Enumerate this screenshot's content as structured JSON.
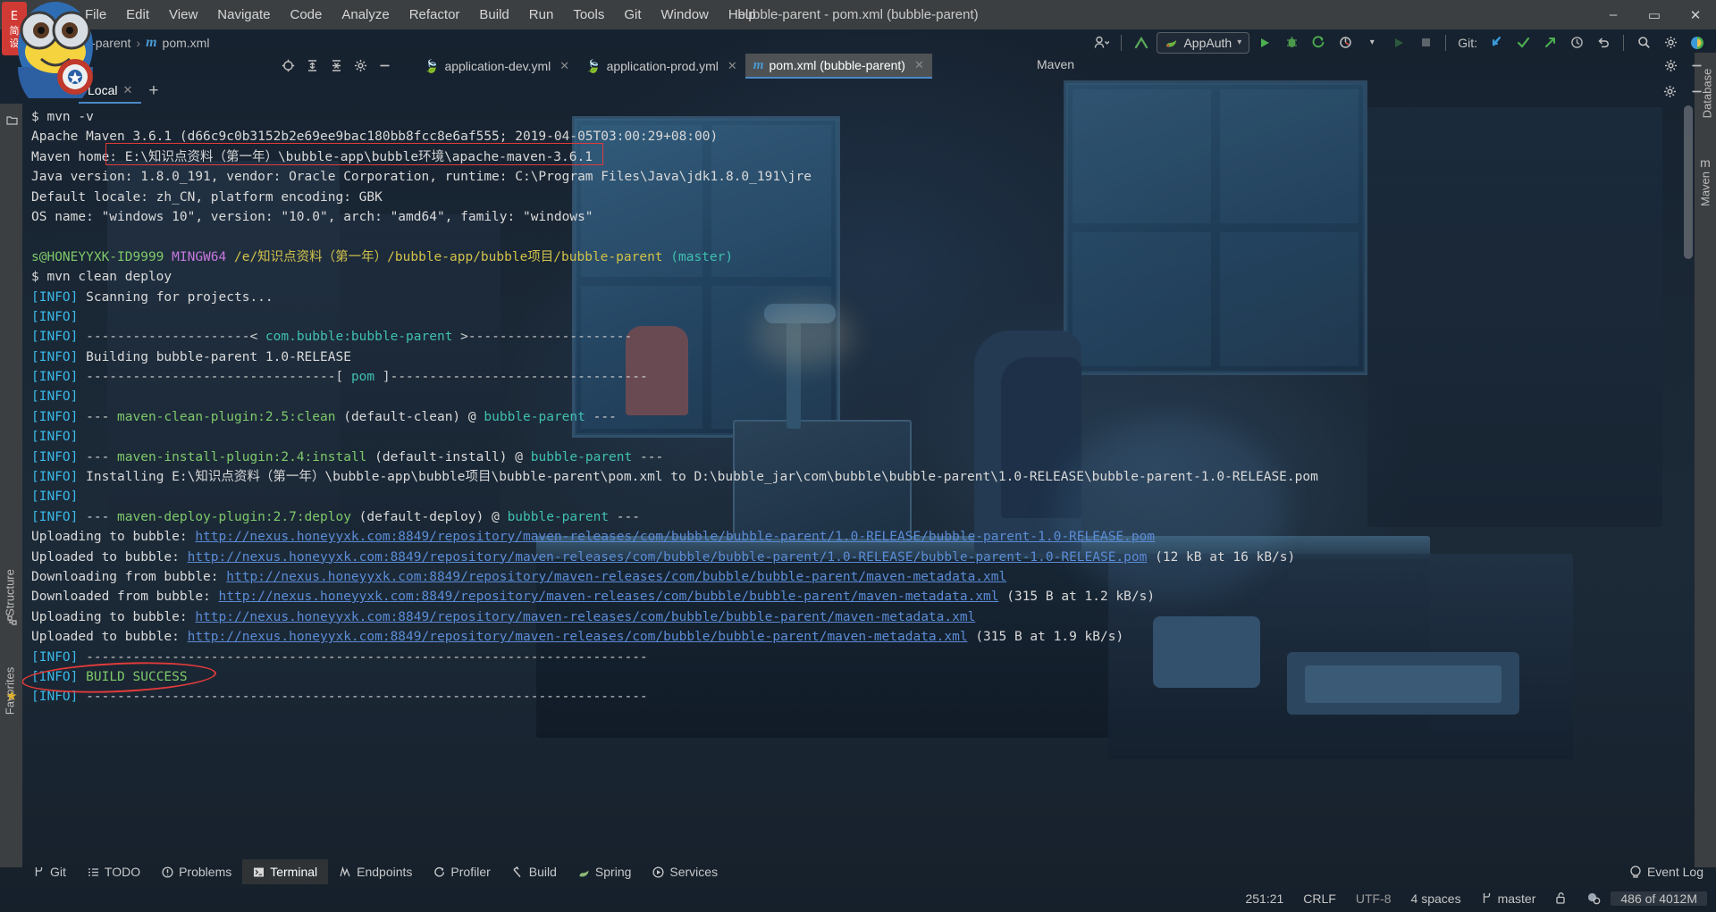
{
  "window": {
    "title": "bubble-parent - pom.xml (bubble-parent)",
    "minimize": "–",
    "maximize": "▭",
    "close": "✕"
  },
  "menu": [
    {
      "label": "File"
    },
    {
      "label": "Edit"
    },
    {
      "label": "View"
    },
    {
      "label": "Navigate"
    },
    {
      "label": "Code"
    },
    {
      "label": "Analyze"
    },
    {
      "label": "Refactor"
    },
    {
      "label": "Build"
    },
    {
      "label": "Run"
    },
    {
      "label": "Tools"
    },
    {
      "label": "Git"
    },
    {
      "label": "Window"
    },
    {
      "label": "Help"
    }
  ],
  "breadcrumb": {
    "project": "bubble-parent",
    "separator": "›",
    "file": "pom.xml",
    "file_icon": "m"
  },
  "toolbar": {
    "run_config": "AppAuth",
    "run_config_caret": "▾",
    "git_label": "Git:",
    "icons": [
      "user-avatar-icon",
      "update-project-icon",
      "run-icon",
      "debug-icon",
      "run-with-coverage-icon",
      "profile-icon",
      "stop-icon",
      "git-update-icon",
      "git-commit-icon",
      "git-push-icon",
      "history-icon",
      "undo-icon",
      "search-everywhere-icon",
      "settings-icon",
      "theme-icon"
    ]
  },
  "editor_tabs": [
    {
      "label": "application-dev.yml",
      "icon": "spring-yml-icon",
      "active": false,
      "close": "✕"
    },
    {
      "label": "application-prod.yml",
      "icon": "spring-yml-icon",
      "active": false,
      "close": "✕"
    },
    {
      "label": "pom.xml (bubble-parent)",
      "icon": "maven-icon",
      "active": true,
      "close": "✕"
    }
  ],
  "maven_panel_label": "Maven",
  "terminal_tabs": [
    {
      "label": "Local",
      "active": true,
      "close": "✕"
    }
  ],
  "terminal_tab_add": "+",
  "left_strip": {
    "items": [
      "Structure",
      "Favorites"
    ],
    "icons": [
      "project-icon",
      "structure-icon",
      "favorites-star-icon"
    ]
  },
  "right_strip": {
    "items": [
      "Database",
      "Maven"
    ]
  },
  "terminal": {
    "lines": [
      {
        "segs": [
          {
            "t": "$ mvn -v",
            "c": "c-white"
          }
        ]
      },
      {
        "segs": [
          {
            "t": "Apache Maven 3.6.1 (d66c9c0b3152b2e69ee9bac180bb8fcc8e6af555; 2019-04-05T03:00:29+08:00)",
            "c": "c-white"
          }
        ]
      },
      {
        "segs": [
          {
            "t": "Maven home: E:\\知识点资料（第一年）\\bubble-app\\bubble环境\\apache-maven-3.6.1",
            "c": "c-white"
          }
        ]
      },
      {
        "segs": [
          {
            "t": "Java version: 1.8.0_191, vendor: Oracle Corporation, runtime: C:\\Program Files\\Java\\jdk1.8.0_191\\jre",
            "c": "c-white"
          }
        ]
      },
      {
        "segs": [
          {
            "t": "Default locale: zh_CN, platform encoding: GBK",
            "c": "c-white"
          }
        ]
      },
      {
        "segs": [
          {
            "t": "OS name: \"windows 10\", version: \"10.0\", arch: \"amd64\", family: \"windows\"",
            "c": "c-white"
          }
        ]
      },
      {
        "segs": [
          {
            "t": "",
            "c": "c-white"
          }
        ]
      },
      {
        "segs": [
          {
            "t": "s@HONEYYXK-ID9999 ",
            "c": "c-green"
          },
          {
            "t": "MINGW64 ",
            "c": "c-magenta"
          },
          {
            "t": "/e/知识点资料（第一年）/bubble-app/bubble项目/bubble-parent ",
            "c": "c-yellow"
          },
          {
            "t": "(master)",
            "c": "c-teal"
          }
        ]
      },
      {
        "segs": [
          {
            "t": "$ mvn clean deploy",
            "c": "c-white"
          }
        ]
      },
      {
        "segs": [
          {
            "t": "[INFO]",
            "c": "c-info"
          },
          {
            "t": " Scanning for projects...",
            "c": "c-white"
          }
        ]
      },
      {
        "segs": [
          {
            "t": "[INFO]",
            "c": "c-info"
          }
        ]
      },
      {
        "segs": [
          {
            "t": "[INFO]",
            "c": "c-info"
          },
          {
            "t": " ---------------------< ",
            "c": "c-dash"
          },
          {
            "t": "com.bubble:bubble-parent",
            "c": "c-teal"
          },
          {
            "t": " >---------------------",
            "c": "c-dash"
          }
        ]
      },
      {
        "segs": [
          {
            "t": "[INFO]",
            "c": "c-info"
          },
          {
            "t": " Building bubble-parent 1.0-RELEASE",
            "c": "c-white"
          }
        ]
      },
      {
        "segs": [
          {
            "t": "[INFO]",
            "c": "c-info"
          },
          {
            "t": " --------------------------------[ ",
            "c": "c-dash"
          },
          {
            "t": "pom",
            "c": "c-teal"
          },
          {
            "t": " ]---------------------------------",
            "c": "c-dash"
          }
        ]
      },
      {
        "segs": [
          {
            "t": "[INFO]",
            "c": "c-info"
          }
        ]
      },
      {
        "segs": [
          {
            "t": "[INFO]",
            "c": "c-info"
          },
          {
            "t": " --- ",
            "c": "c-white"
          },
          {
            "t": "maven-clean-plugin:2.5:clean",
            "c": "c-green"
          },
          {
            "t": " (default-clean)",
            "c": "c-white"
          },
          {
            "t": " @ ",
            "c": "c-white"
          },
          {
            "t": "bubble-parent",
            "c": "c-teal"
          },
          {
            "t": " ---",
            "c": "c-white"
          }
        ]
      },
      {
        "segs": [
          {
            "t": "[INFO]",
            "c": "c-info"
          }
        ]
      },
      {
        "segs": [
          {
            "t": "[INFO]",
            "c": "c-info"
          },
          {
            "t": " --- ",
            "c": "c-white"
          },
          {
            "t": "maven-install-plugin:2.4:install",
            "c": "c-green"
          },
          {
            "t": " (default-install)",
            "c": "c-white"
          },
          {
            "t": " @ ",
            "c": "c-white"
          },
          {
            "t": "bubble-parent",
            "c": "c-teal"
          },
          {
            "t": " ---",
            "c": "c-white"
          }
        ]
      },
      {
        "segs": [
          {
            "t": "[INFO]",
            "c": "c-info"
          },
          {
            "t": " Installing E:\\知识点资料（第一年）\\bubble-app\\bubble项目\\bubble-parent\\pom.xml to D:\\bubble_jar\\com\\bubble\\bubble-parent\\1.0-RELEASE\\bubble-parent-1.0-RELEASE.pom",
            "c": "c-white"
          }
        ]
      },
      {
        "segs": [
          {
            "t": "[INFO]",
            "c": "c-info"
          }
        ]
      },
      {
        "segs": [
          {
            "t": "[INFO]",
            "c": "c-info"
          },
          {
            "t": " --- ",
            "c": "c-white"
          },
          {
            "t": "maven-deploy-plugin:2.7:deploy",
            "c": "c-green"
          },
          {
            "t": " (default-deploy)",
            "c": "c-white"
          },
          {
            "t": " @ ",
            "c": "c-white"
          },
          {
            "t": "bubble-parent",
            "c": "c-teal"
          },
          {
            "t": " ---",
            "c": "c-white"
          }
        ]
      },
      {
        "segs": [
          {
            "t": "Uploading to bubble: ",
            "c": "c-white"
          },
          {
            "t": "http://nexus.honeyyxk.com:8849/repository/maven-releases/com/bubble/bubble-parent/1.0-RELEASE/bubble-parent-1.0-RELEASE.pom",
            "c": "c-link"
          }
        ]
      },
      {
        "segs": [
          {
            "t": "Uploaded to bubble: ",
            "c": "c-white"
          },
          {
            "t": "http://nexus.honeyyxk.com:8849/repository/maven-releases/com/bubble/bubble-parent/1.0-RELEASE/bubble-parent-1.0-RELEASE.pom",
            "c": "c-link"
          },
          {
            "t": " (12 kB at 16 kB/s)",
            "c": "c-white"
          }
        ]
      },
      {
        "segs": [
          {
            "t": "Downloading from bubble: ",
            "c": "c-white"
          },
          {
            "t": "http://nexus.honeyyxk.com:8849/repository/maven-releases/com/bubble/bubble-parent/maven-metadata.xml",
            "c": "c-link"
          }
        ]
      },
      {
        "segs": [
          {
            "t": "Downloaded from bubble: ",
            "c": "c-white"
          },
          {
            "t": "http://nexus.honeyyxk.com:8849/repository/maven-releases/com/bubble/bubble-parent/maven-metadata.xml",
            "c": "c-link"
          },
          {
            "t": " (315 B at 1.2 kB/s)",
            "c": "c-white"
          }
        ]
      },
      {
        "segs": [
          {
            "t": "Uploading to bubble: ",
            "c": "c-white"
          },
          {
            "t": "http://nexus.honeyyxk.com:8849/repository/maven-releases/com/bubble/bubble-parent/maven-metadata.xml",
            "c": "c-link"
          }
        ]
      },
      {
        "segs": [
          {
            "t": "Uploaded to bubble: ",
            "c": "c-white"
          },
          {
            "t": "http://nexus.honeyyxk.com:8849/repository/maven-releases/com/bubble/bubble-parent/maven-metadata.xml",
            "c": "c-link"
          },
          {
            "t": " (315 B at 1.9 kB/s)",
            "c": "c-white"
          }
        ]
      },
      {
        "segs": [
          {
            "t": "[INFO]",
            "c": "c-info"
          },
          {
            "t": " ------------------------------------------------------------------------",
            "c": "c-dash"
          }
        ]
      },
      {
        "segs": [
          {
            "t": "[INFO]",
            "c": "c-info"
          },
          {
            "t": " ",
            "c": "c-white"
          },
          {
            "t": "BUILD SUCCESS",
            "c": "c-green"
          }
        ]
      },
      {
        "segs": [
          {
            "t": "[INFO]",
            "c": "c-info"
          },
          {
            "t": " ------------------------------------------------------------------------",
            "c": "c-dash"
          }
        ]
      }
    ]
  },
  "bottom_tools": [
    {
      "label": "Git",
      "icon": "git-branch-icon",
      "active": false
    },
    {
      "label": "TODO",
      "icon": "todo-list-icon",
      "active": false
    },
    {
      "label": "Problems",
      "icon": "problems-warning-icon",
      "active": false
    },
    {
      "label": "Terminal",
      "icon": "terminal-icon",
      "active": true
    },
    {
      "label": "Endpoints",
      "icon": "endpoints-icon",
      "active": false
    },
    {
      "label": "Profiler",
      "icon": "profiler-icon",
      "active": false
    },
    {
      "label": "Build",
      "icon": "build-hammer-icon",
      "active": false
    },
    {
      "label": "Spring",
      "icon": "spring-leaf-icon",
      "active": false
    },
    {
      "label": "Services",
      "icon": "services-play-icon",
      "active": false
    }
  ],
  "event_log": {
    "label": "Event Log",
    "icon": "balloon-icon"
  },
  "status_bar": {
    "caret": "251:21",
    "line_separator": "CRLF",
    "encoding": "UTF-8",
    "indent": "4 spaces",
    "branch": "master",
    "branch_icon": "git-branch-icon",
    "lock_icon": "unlocked-icon",
    "inspection_icon": "inspection-icon",
    "memory": "486 of 4012M"
  },
  "annotations": {
    "maven_home_box": "red-rectangle-highlight",
    "build_success_ellipse": "red-ellipse-highlight"
  },
  "colors": {
    "accent_blue": "#4a88c7",
    "info_cyan": "#3ab9e8",
    "success_green": "#7ec96a",
    "link_blue": "#5b8cd6",
    "highlight_red": "#e03b3b",
    "chrome_gray": "#3c3f41"
  }
}
